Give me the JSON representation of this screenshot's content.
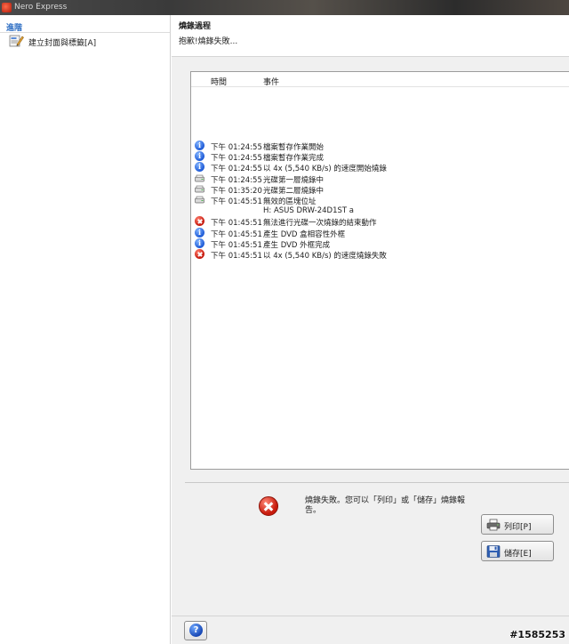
{
  "window": {
    "title": "Nero Express"
  },
  "sidebar": {
    "heading": "進階",
    "items": [
      {
        "label": "建立封面與標籤[A]",
        "icon": "cover-label-icon"
      }
    ]
  },
  "header": {
    "title": "燒錄過程",
    "subtitle": "抱歉!燒錄失敗..."
  },
  "log": {
    "columns": {
      "time": "時間",
      "event": "事件"
    },
    "rows": [
      {
        "icon": "info",
        "time": "下午 01:24:55",
        "event": "檔案暫存作業開始"
      },
      {
        "icon": "info",
        "time": "下午 01:24:55",
        "event": "檔案暫存作業完成"
      },
      {
        "icon": "info",
        "time": "下午 01:24:55",
        "event": "以 4x (5,540 KB/s) 的速度開始燒錄"
      },
      {
        "icon": "drive",
        "time": "下午 01:24:55",
        "event": "光碟第一層燒錄中"
      },
      {
        "icon": "drive",
        "time": "下午 01:35:20",
        "event": "光碟第二層燒錄中"
      },
      {
        "icon": "drive",
        "time": "下午 01:45:51",
        "event": "無效的區塊位址"
      },
      {
        "icon": "none",
        "time": "",
        "event": "H: ASUS DRW-24D1ST   a"
      },
      {
        "icon": "error",
        "time": "下午 01:45:51",
        "event": "無法進行光碟一次燒錄的結束動作"
      },
      {
        "icon": "info",
        "time": "下午 01:45:51",
        "event": "產生 DVD 盒相容性外框"
      },
      {
        "icon": "info",
        "time": "下午 01:45:51",
        "event": "產生 DVD 外框完成"
      },
      {
        "icon": "error",
        "time": "下午 01:45:51",
        "event": "以 4x (5,540 KB/s) 的速度燒錄失敗"
      }
    ]
  },
  "status": {
    "message": "燒錄失敗。您可以「列印」或「儲存」燒錄報告。"
  },
  "buttons": {
    "print": "列印[P]",
    "save": "儲存[E]"
  },
  "help": {
    "label": "?"
  },
  "watermark": "#1585253"
}
